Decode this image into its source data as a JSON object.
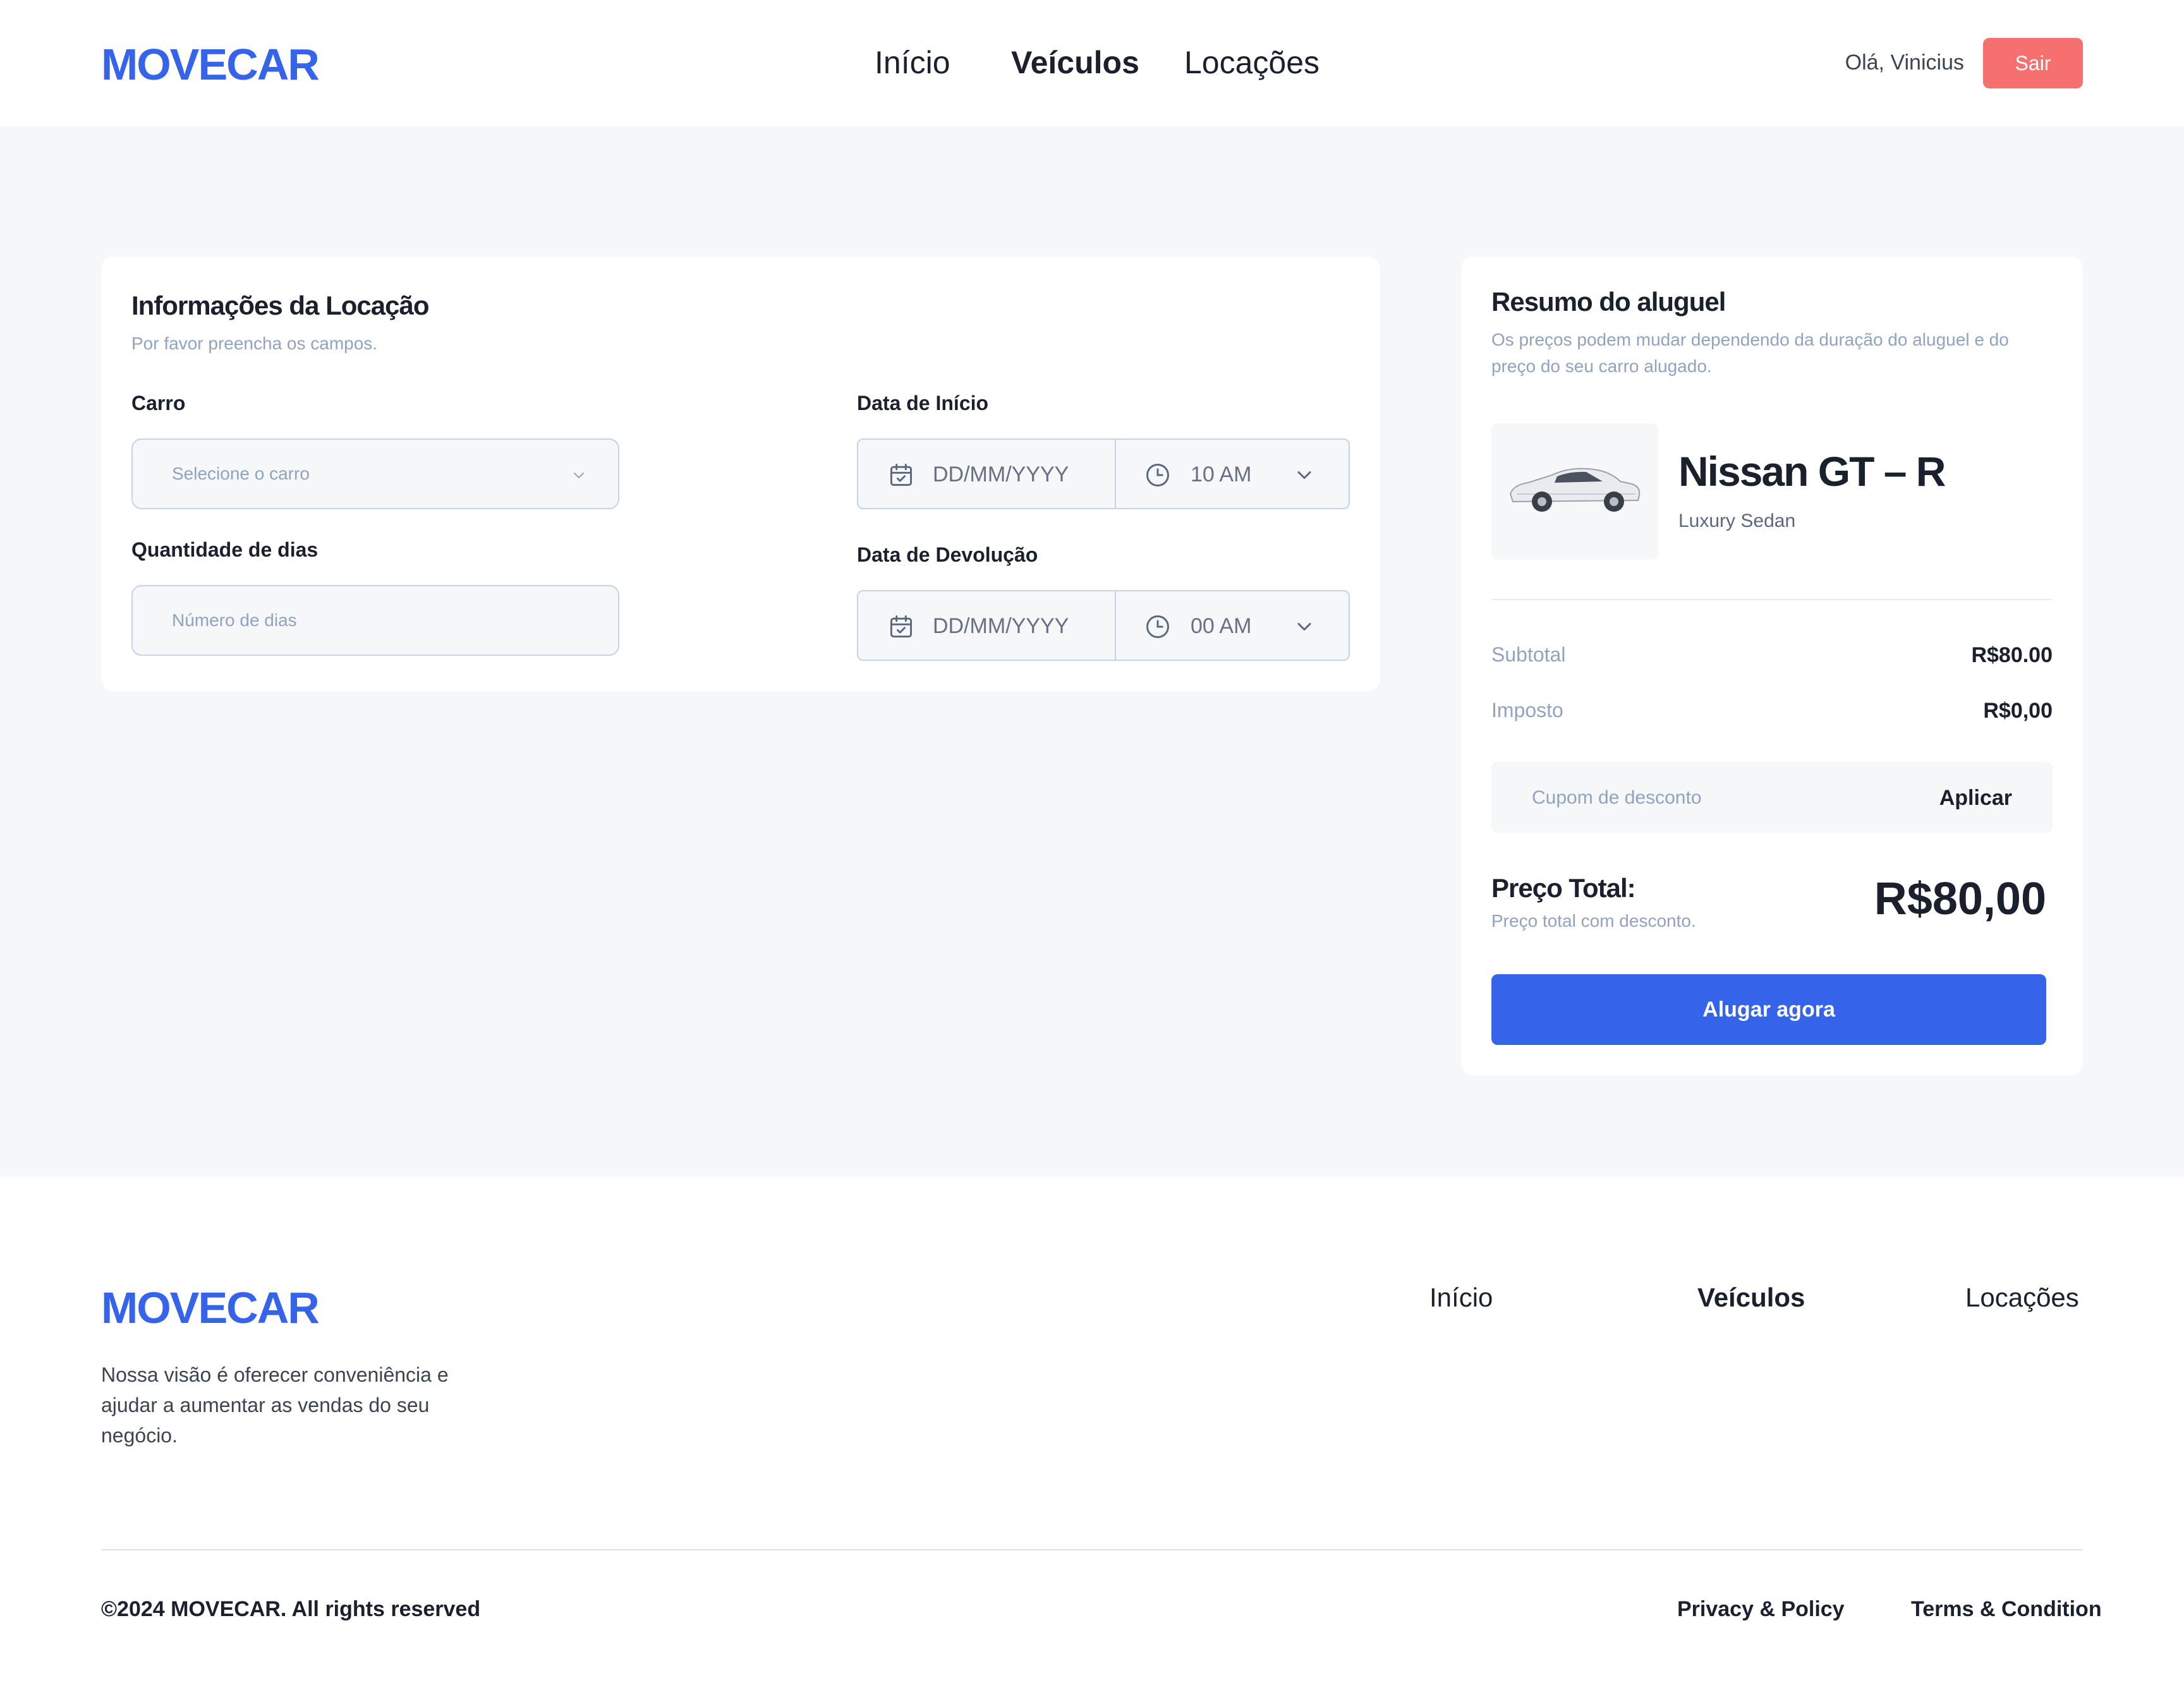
{
  "header": {
    "logo": "MOVECAR",
    "nav": [
      {
        "label": "Início",
        "active": false
      },
      {
        "label": "Veículos",
        "active": true
      },
      {
        "label": "Locações",
        "active": false
      }
    ],
    "greeting": "Olá, Vinicius",
    "logout_label": "Sair"
  },
  "form": {
    "title": "Informações da Locação",
    "subtitle": "Por favor preencha os campos.",
    "car_label": "Carro",
    "car_placeholder": "Selecione o carro",
    "days_label": "Quantidade de dias",
    "days_placeholder": "Número de dias",
    "start_label": "Data de Início",
    "start_date_placeholder": "DD/MM/YYYY",
    "start_time": "10 AM",
    "return_label": "Data de Devolução",
    "return_date_placeholder": "DD/MM/YYYY",
    "return_time": "00 AM"
  },
  "summary": {
    "title": "Resumo do aluguel",
    "subtitle_line1": "Os preços podem mudar dependendo da duração do aluguel e do",
    "subtitle_line2": "preço do seu carro alugado.",
    "car_name": "Nissan GT – R",
    "car_type": "Luxury Sedan",
    "subtotal_label": "Subtotal",
    "subtotal_value": "R$80.00",
    "tax_label": "Imposto",
    "tax_value": "R$0,00",
    "coupon_placeholder": "Cupom de desconto",
    "coupon_apply": "Aplicar",
    "total_label": "Preço Total:",
    "total_sub": "Preço total com desconto.",
    "total_value": "R$80,00",
    "rent_button": "Alugar agora"
  },
  "footer": {
    "logo": "MOVECAR",
    "desc_line1": "Nossa visão é oferecer conveniência e",
    "desc_line2": "ajudar a aumentar as vendas do seu",
    "desc_line3": "negócio.",
    "links": [
      {
        "label": "Início",
        "active": false
      },
      {
        "label": "Veículos",
        "active": true
      },
      {
        "label": "Locações",
        "active": false
      }
    ],
    "copyright": "©2024 MOVECAR. All rights reserved",
    "privacy": "Privacy & Policy",
    "terms": "Terms & Condition"
  },
  "colors": {
    "brand": "#3563e9",
    "logout": "#f77070",
    "background": "#f6f7f9"
  }
}
